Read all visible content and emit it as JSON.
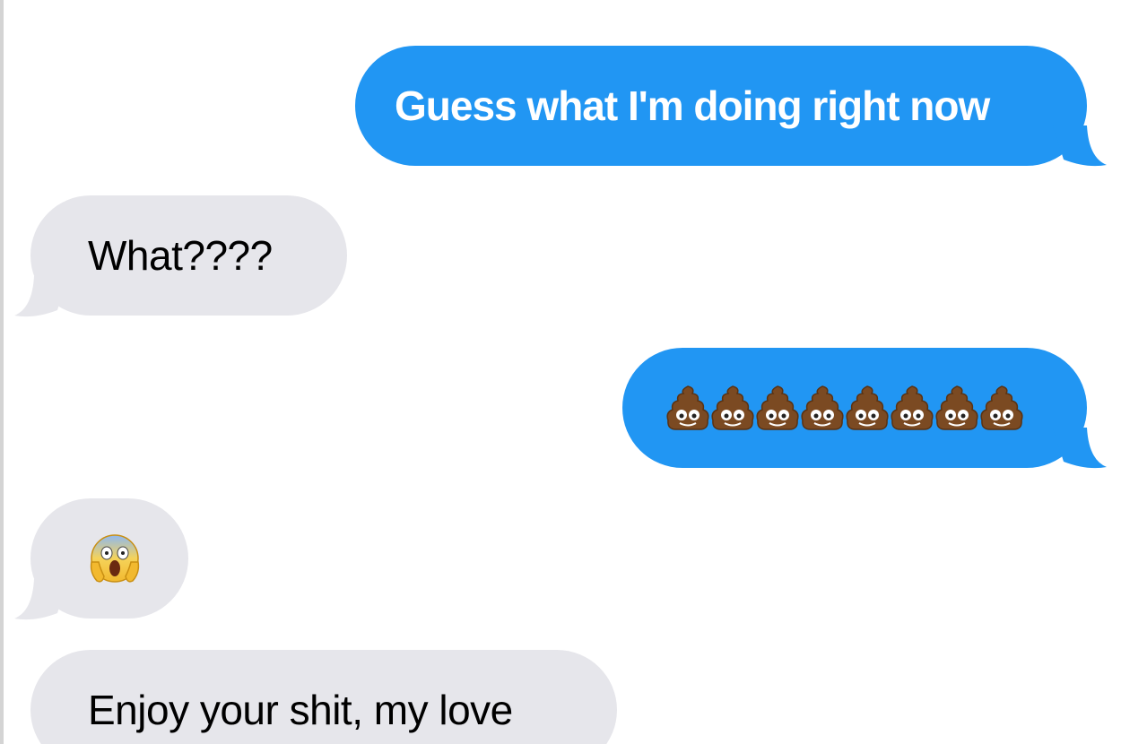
{
  "conversation": {
    "colors": {
      "outgoing_bubble": "#2196f3",
      "incoming_bubble": "#e6e6eb",
      "outgoing_text": "#ffffff",
      "incoming_text": "#000000"
    },
    "messages": [
      {
        "direction": "outgoing",
        "text": "Guess what I'm doing right now"
      },
      {
        "direction": "incoming",
        "text": "What????"
      },
      {
        "direction": "outgoing",
        "emoji": "pile-of-poo",
        "count": 8
      },
      {
        "direction": "incoming",
        "emoji": "face-screaming-in-fear"
      },
      {
        "direction": "incoming",
        "text": "Enjoy your shit, my love"
      }
    ]
  }
}
